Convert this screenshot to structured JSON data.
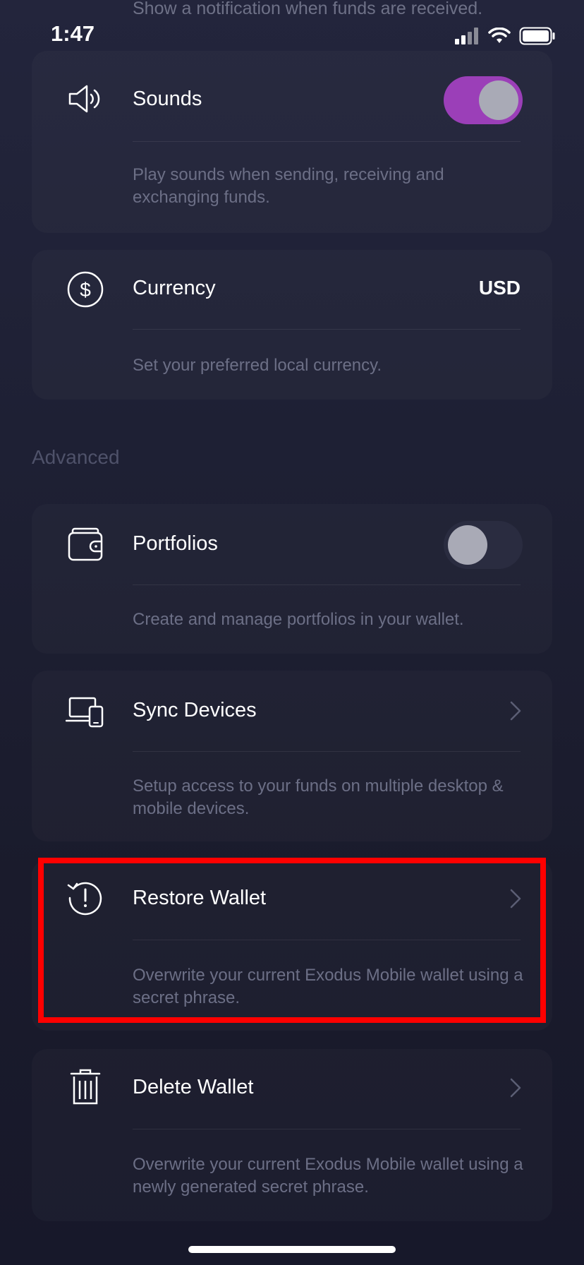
{
  "status_bar": {
    "time": "1:47"
  },
  "top_caption": "Show a notification when funds are received.",
  "cards": {
    "sounds": {
      "title": "Sounds",
      "description": "Play sounds when sending, receiving and exchanging funds.",
      "toggle_on": true,
      "icon": "speaker-icon"
    },
    "currency": {
      "title": "Currency",
      "value": "USD",
      "description": "Set your preferred local currency.",
      "icon": "dollar-icon"
    },
    "portfolios": {
      "title": "Portfolios",
      "description": "Create and manage portfolios in your wallet.",
      "toggle_on": false,
      "icon": "wallet-icon"
    },
    "sync_devices": {
      "title": "Sync Devices",
      "description": "Setup access to your funds on multiple desktop & mobile devices.",
      "icon": "devices-icon"
    },
    "restore_wallet": {
      "title": "Restore Wallet",
      "description": "Overwrite your current Exodus Mobile wallet using a secret phrase.",
      "icon": "restore-icon"
    },
    "delete_wallet": {
      "title": "Delete Wallet",
      "description": "Overwrite your current Exodus Mobile wallet using a newly generated secret phrase.",
      "icon": "trash-icon"
    }
  },
  "sections": {
    "advanced": "Advanced"
  },
  "colors": {
    "toggle_on": "#9b3fb8",
    "highlight": "#ff0000",
    "background": "#1e2034"
  }
}
